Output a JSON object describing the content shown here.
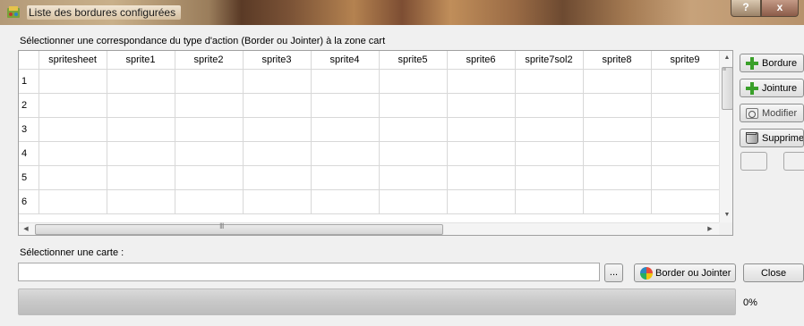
{
  "window": {
    "title": "Liste des bordures configurées",
    "help_label": "?",
    "close_label": "x"
  },
  "instruction": "Sélectionner une correspondance du type d'action (Border ou Jointer) à la zone cart",
  "table": {
    "columns": [
      "spritesheet",
      "sprite1",
      "sprite2",
      "sprite3",
      "sprite4",
      "sprite5",
      "sprite6",
      "sprite7sol2",
      "sprite8",
      "sprite9"
    ],
    "rows": [
      "1",
      "2",
      "3",
      "4",
      "5",
      "6"
    ],
    "hscroll_grip": "III"
  },
  "side_buttons": {
    "bordure": "Bordure",
    "jointure": "Jointure",
    "modifier": "Modifier",
    "supprimer": "Supprimer"
  },
  "map_section": {
    "label": "Sélectionner une carte :",
    "input_value": "",
    "browse_label": "...",
    "border_jointer_label": "Border ou Jointer",
    "close_label": "Close"
  },
  "progress": {
    "value": 0,
    "label": "0%"
  }
}
